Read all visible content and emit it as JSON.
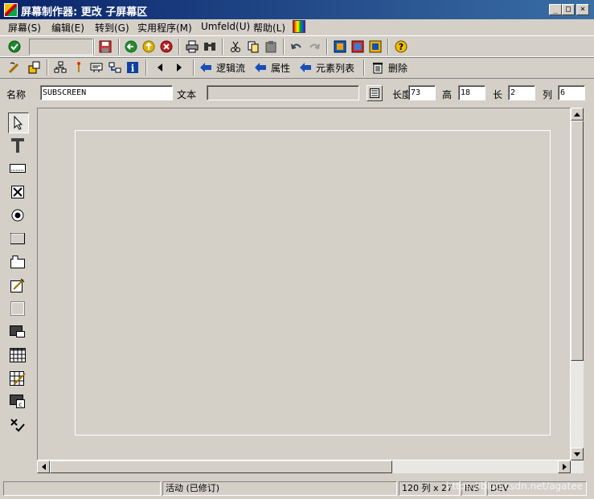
{
  "window": {
    "title": "屏幕制作器:   更改 子屏幕区",
    "buttons": {
      "minimize": "_",
      "maximize": "□",
      "close": "×"
    }
  },
  "menubar": [
    {
      "label": "屏幕(S)"
    },
    {
      "label": "编辑(E)"
    },
    {
      "label": "转到(G)"
    },
    {
      "label": "实用程序(M)"
    },
    {
      "label": "Umfeld(U)"
    },
    {
      "label": "帮助(L)"
    }
  ],
  "toolbar2": {
    "logic_flow": "逻辑流",
    "attributes": "属性",
    "element_list": "元素列表",
    "delete": "删除"
  },
  "fields": {
    "name_label": "名称",
    "name_value": "SUBSCREEN",
    "text_label": "文本",
    "text_value": "",
    "length_label": "长度",
    "length_value": "73",
    "height_label": "高",
    "height_value": "18",
    "long_label": "长",
    "long_value": "2",
    "col_label": "列",
    "col_value": "6"
  },
  "statusbar": {
    "left": "",
    "status": "活动  (已修订)",
    "position": "120 列 x 27",
    "mode": "INS",
    "system": "DEV"
  },
  "watermark": "https://blog.csdn.net/agatee",
  "colors": {
    "title_start": "#0a246a",
    "title_end": "#3a6ea5",
    "face": "#d4d0c8",
    "arrow_blue": "#1a4fb5"
  }
}
